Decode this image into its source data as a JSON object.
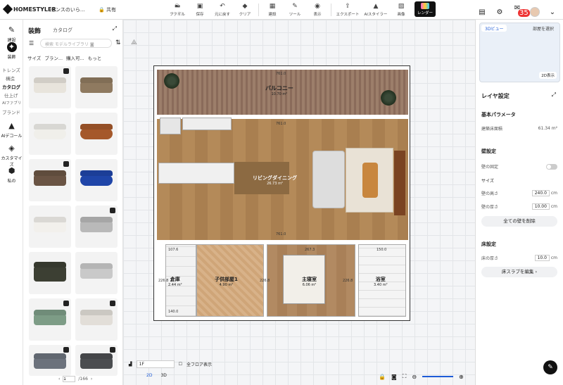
{
  "app": {
    "brand": "HOMESTYLER",
    "project": "センスのいら...",
    "share": "共有"
  },
  "toolbar": [
    {
      "label": "ファイル",
      "icon": "folder-icon"
    },
    {
      "label": "保存",
      "icon": "save-icon"
    },
    {
      "label": "元に戻す",
      "icon": "undo-icon"
    },
    {
      "label": "やり直し",
      "icon": "redo-icon"
    },
    {
      "label": "クリア",
      "icon": "clear-icon"
    },
    {
      "label": "建設",
      "icon": "build-icon"
    },
    {
      "label": "ツール",
      "icon": "tools-icon"
    },
    {
      "label": "表示",
      "icon": "eye-icon"
    },
    {
      "label": "エクスポート",
      "icon": "export-icon"
    },
    {
      "label": "AIスタイラー",
      "icon": "ai-icon"
    },
    {
      "label": "画像",
      "icon": "image-icon"
    },
    {
      "label": "レンダー",
      "icon": "render-icon"
    }
  ],
  "header_right": {
    "notifications": "35"
  },
  "leftnav": [
    {
      "label": "建設",
      "icon": "build-icon"
    },
    {
      "label": "装飾",
      "icon": "decor-icon"
    },
    {
      "label": "AIデコール",
      "icon": "ai-decor-icon"
    },
    {
      "label": "カスタマイズ",
      "icon": "customize-icon"
    },
    {
      "label": "私の",
      "icon": "mine-icon"
    }
  ],
  "subnav": [
    "トレンズ",
    "構造",
    "カタログ",
    "仕上げ",
    "AIファブリ",
    "ブランド"
  ],
  "catalog": {
    "title": "装飾",
    "subtitle": "カタログ",
    "search_placeholder": "検索 モデルライブラリ",
    "filters": [
      "サイズ",
      "ブラン...",
      "購入可...",
      "もっと"
    ],
    "page": "1",
    "total": "/166"
  },
  "plan": {
    "rooms": [
      {
        "name": "バルコニー",
        "area": "10.70 m²"
      },
      {
        "name": "リビングダイニング",
        "area": "26.73 m²"
      },
      {
        "name": "倉庫",
        "area": "2.44 m²"
      },
      {
        "name": "子供部屋1",
        "area": "4.90 m²"
      },
      {
        "name": "主寝室",
        "area": "6.06 m²"
      },
      {
        "name": "浴室",
        "area": "3.40 m²"
      }
    ],
    "dims": [
      "761.0",
      "761.0",
      "761.0",
      "226.8",
      "226.8",
      "226.8",
      "107.6",
      "267.3",
      "150.0",
      "140.0"
    ]
  },
  "bottom": {
    "floor": "1F",
    "all_floors": "全フロア表示",
    "view2d": "2D",
    "view3d": "3D"
  },
  "rightpanel": {
    "tab_3d": "3Dビュー",
    "tab_room": "部屋を選択",
    "mini_label": "2D表示",
    "title": "レイヤ設定",
    "basic": "基本パラメータ",
    "floor_area_label": "建築床面積",
    "floor_area_value": "61.34 m²",
    "wall_settings": "壁設定",
    "wall_lock": "壁の固定",
    "size": "サイズ",
    "wall_height_label": "壁の高さ",
    "wall_height_value": "240.0",
    "wall_thickness_label": "壁の厚さ",
    "wall_thickness_value": "10.00",
    "unit": "cm",
    "delete_walls": "全ての壁を削除",
    "floor_settings": "床設定",
    "floor_thickness_label": "床の厚さ",
    "floor_thickness_value": "10.0",
    "edit_slab": "床スラブを編集 ›"
  }
}
